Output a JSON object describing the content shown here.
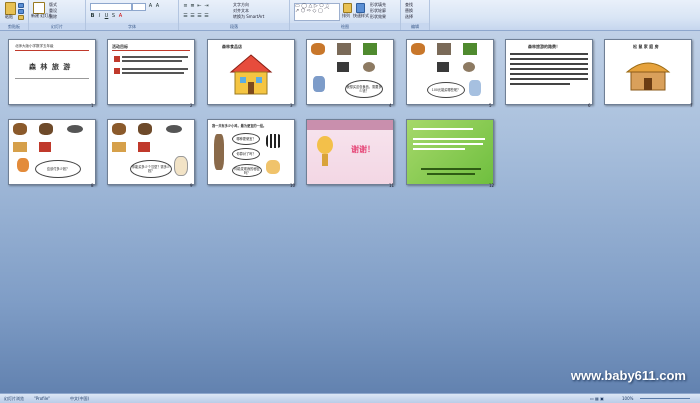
{
  "ribbon": {
    "groups": [
      {
        "label": "剪贴板"
      },
      {
        "label": "幻灯片"
      },
      {
        "label": "字体"
      },
      {
        "label": "段落"
      },
      {
        "label": "绘图"
      },
      {
        "label": "编辑"
      }
    ],
    "paste": "粘贴",
    "new_slide": "新建\n幻灯片",
    "layout": "版式",
    "reset": "重设",
    "delete": "删除",
    "text_direction": "文字方向",
    "align_text": "对齐文本",
    "convert_smartart": "转换为 SmartArt",
    "arrange": "排列",
    "quick_styles": "快速样式",
    "shape_fill": "形状填充",
    "shape_outline": "形状轮廓",
    "shape_effects": "形状效果",
    "find": "查找",
    "replace": "替换",
    "select": "选择"
  },
  "slides": [
    {
      "n": "1",
      "title": "森 林 旅 游",
      "sub": "北师大版小学数学五年级"
    },
    {
      "n": "2",
      "title": "活动目标"
    },
    {
      "n": "3",
      "title": "森林食品店"
    },
    {
      "n": "4",
      "bubble": "我想买这包食品，需要多少钱？"
    },
    {
      "n": "5",
      "bubble": "100元能买哪些呢？"
    },
    {
      "n": "6",
      "title": "森林旅游的路费！"
    },
    {
      "n": "7",
      "title": "松 鼠 家 庭 房"
    },
    {
      "n": "8",
      "bubble": "应该付多少钱？"
    },
    {
      "n": "9",
      "bubble": "你能买多少个汉堡？需多少钱？"
    },
    {
      "n": "10",
      "title": "我一共有多少小鸡，最为便宜的一组。",
      "bubble1": "哪种更便宜？",
      "bubble2": "你算对了吗？",
      "bubble3": "你能发现我的秘密吗？"
    },
    {
      "n": "11",
      "title": "谢谢！"
    },
    {
      "n": "12"
    }
  ],
  "status": {
    "view": "幻灯片浏览",
    "theme": "\"Profile\"",
    "lang": "中文(中国)",
    "zoom": "100%"
  },
  "watermark": "www.baby611.com"
}
